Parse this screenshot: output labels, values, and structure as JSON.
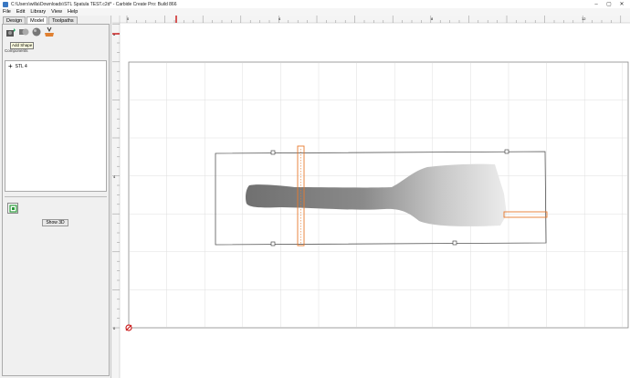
{
  "window": {
    "title": "C:\\Users\\willa\\Downloads\\STL Spatula TEST.c2d* - Carbide Create Pro: Build 866"
  },
  "menu": [
    "File",
    "Edit",
    "Library",
    "View",
    "Help"
  ],
  "tabs": [
    "Design",
    "Model",
    "Toolpaths"
  ],
  "active_tab": "Model",
  "toolbar": {
    "tooltip": "Add Shape"
  },
  "components": {
    "label": "Components",
    "items": [
      "STL 4"
    ]
  },
  "buttons": {
    "show3d": "Show 3D"
  },
  "ruler": {
    "top_labels": [
      "0",
      "4",
      "8",
      "12"
    ],
    "left_labels": [
      "8",
      "4",
      "0"
    ]
  },
  "colors": {
    "selection": "#e87a2e",
    "origin": "#cc2222",
    "grid": "#d8d8d8"
  }
}
